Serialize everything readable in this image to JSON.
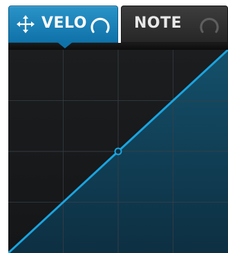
{
  "tabs": [
    {
      "label": "VELO",
      "active": true,
      "icons": [
        "move-icon",
        "knob-icon"
      ]
    },
    {
      "label": "NOTE",
      "active": false,
      "icons": [
        "knob-icon"
      ]
    }
  ],
  "colors": {
    "accent": "#1aa5e0",
    "tab_active": "#1582bb",
    "tab_inactive": "#2e2e2e",
    "graph_background": "#1a1c1e",
    "grid": "#3a3f44"
  },
  "curve": {
    "type": "line",
    "shape": "linear",
    "grid_divisions": 4,
    "x_range": [
      0,
      1
    ],
    "y_range": [
      0,
      1
    ],
    "points": [
      {
        "x": 0,
        "y": 0
      },
      {
        "x": 0.5,
        "y": 0.5
      },
      {
        "x": 1,
        "y": 1
      }
    ],
    "handle_index": 1
  }
}
